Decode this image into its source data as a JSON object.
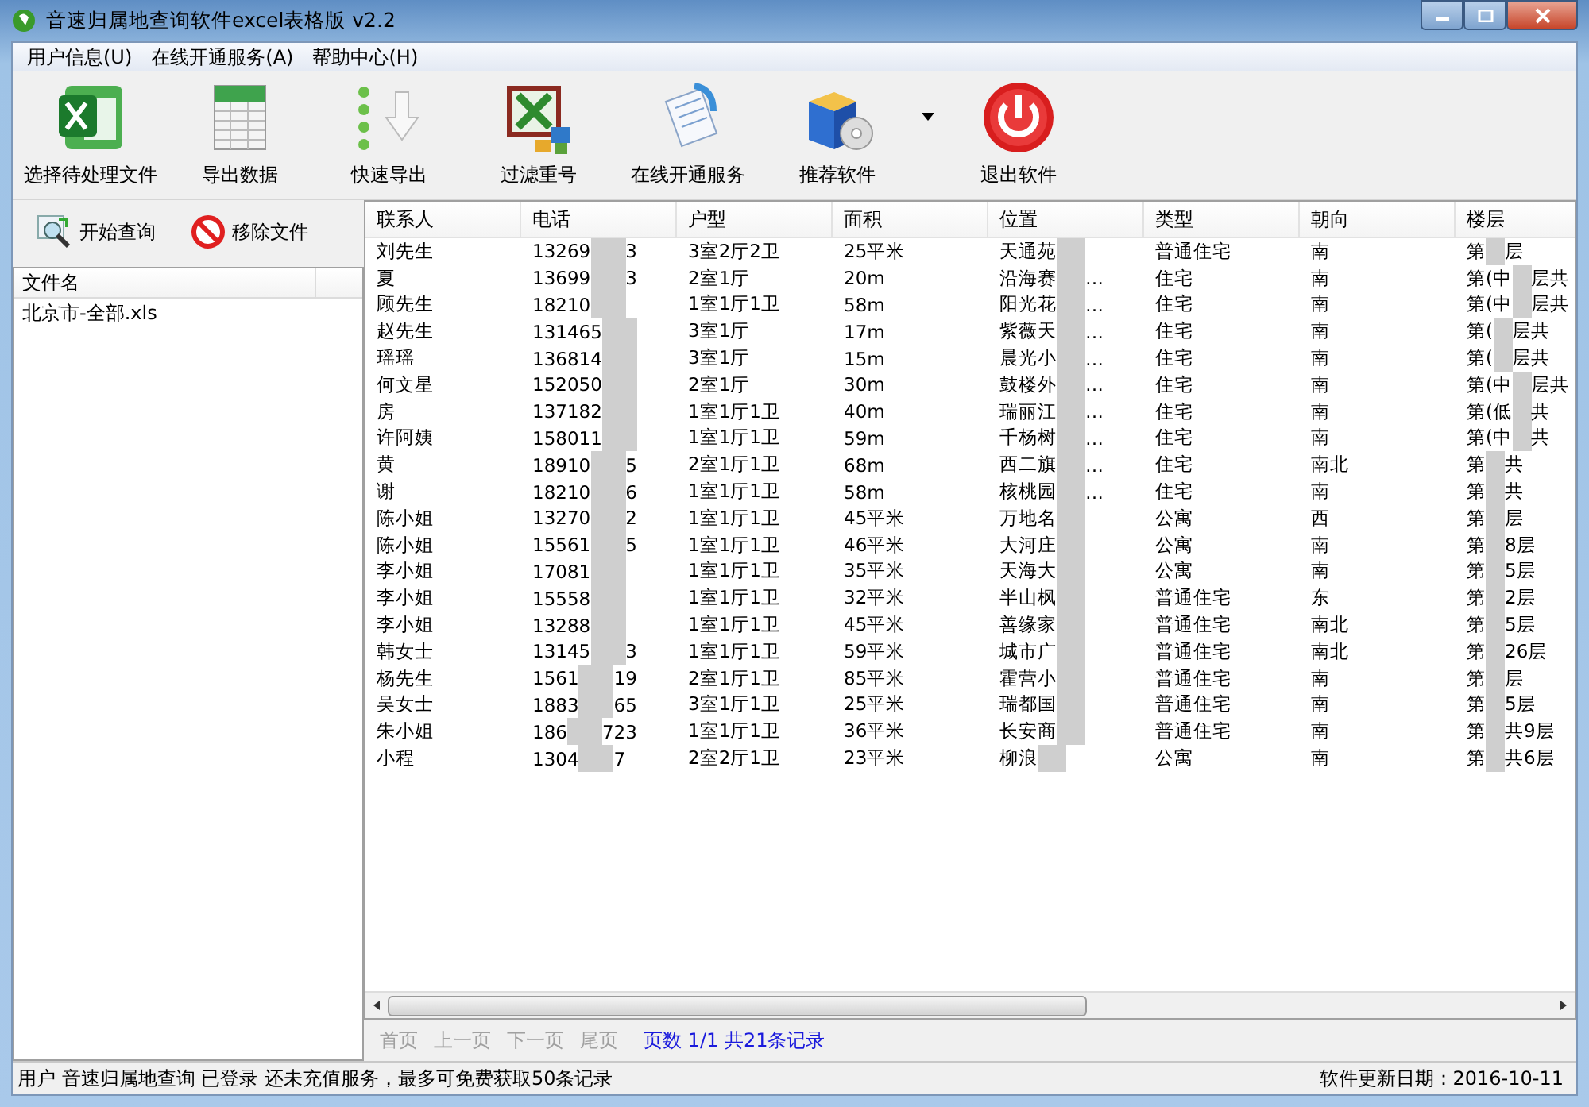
{
  "window": {
    "title": "音速归属地查询软件excel表格版 v2.2"
  },
  "menu": [
    "用户信息(U)",
    "在线开通服务(A)",
    "帮助中心(H)"
  ],
  "toolbar": [
    {
      "label": "选择待处理文件",
      "kind": "excel"
    },
    {
      "label": "导出数据",
      "kind": "sheet"
    },
    {
      "label": "快速导出",
      "kind": "export"
    },
    {
      "label": "过滤重号",
      "kind": "filter"
    },
    {
      "label": "在线开通服务",
      "kind": "online"
    },
    {
      "label": "推荐软件",
      "kind": "box",
      "dropdown": true
    },
    {
      "label": "退出软件",
      "kind": "exit"
    }
  ],
  "side_actions": [
    {
      "label": "开始查询",
      "kind": "search"
    },
    {
      "label": "移除文件",
      "kind": "remove"
    }
  ],
  "file_list": {
    "columns": [
      "文件名"
    ],
    "rows": [
      "北京市-全部.xls"
    ]
  },
  "table": {
    "columns": [
      "联系人",
      "电话",
      "户型",
      "面积",
      "位置",
      "类型",
      "朝向",
      "楼层"
    ],
    "rows": [
      {
        "contact": "刘先生",
        "phone": {
          "head": "13269",
          "tail": "3"
        },
        "layout": "3室2厅2卫",
        "area": "25平米",
        "location": {
          "head": "天通苑"
        },
        "type": "普通住宅",
        "facing": "南",
        "floor": {
          "head": "第",
          "tail": "层"
        }
      },
      {
        "contact": "夏",
        "phone": {
          "head": "13699",
          "tail": "3"
        },
        "layout": "2室1厅",
        "area": "20m",
        "location": {
          "head": "沿海赛",
          "tail": "…"
        },
        "type": "住宅",
        "facing": "南",
        "floor": {
          "head": "第(中",
          "tail": "层共"
        }
      },
      {
        "contact": "顾先生",
        "phone": {
          "head": "18210"
        },
        "layout": "1室1厅1卫",
        "area": "58m",
        "location": {
          "head": "阳光花",
          "tail": "…"
        },
        "type": "住宅",
        "facing": "南",
        "floor": {
          "head": "第(中",
          "tail": "层共"
        }
      },
      {
        "contact": "赵先生",
        "phone": {
          "head": "131465"
        },
        "layout": "3室1厅",
        "area": "17m",
        "location": {
          "head": "紫薇天",
          "tail": "…"
        },
        "type": "住宅",
        "facing": "南",
        "floor": {
          "head": "第(",
          "tail": "层共"
        }
      },
      {
        "contact": "瑶瑶",
        "phone": {
          "head": "136814"
        },
        "layout": "3室1厅",
        "area": "15m",
        "location": {
          "head": "晨光小",
          "tail": "…"
        },
        "type": "住宅",
        "facing": "南",
        "floor": {
          "head": "第(",
          "tail": "层共"
        }
      },
      {
        "contact": "何文星",
        "phone": {
          "head": "152050"
        },
        "layout": "2室1厅",
        "area": "30m",
        "location": {
          "head": "鼓楼外",
          "tail": "…"
        },
        "type": "住宅",
        "facing": "南",
        "floor": {
          "head": "第(中",
          "tail": "层共"
        }
      },
      {
        "contact": "房",
        "phone": {
          "head": "137182"
        },
        "layout": "1室1厅1卫",
        "area": "40m",
        "location": {
          "head": "瑞丽江",
          "tail": "…"
        },
        "type": "住宅",
        "facing": "南",
        "floor": {
          "head": "第(低",
          "tail": "共"
        }
      },
      {
        "contact": "许阿姨",
        "phone": {
          "head": "158011"
        },
        "layout": "1室1厅1卫",
        "area": "59m",
        "location": {
          "head": "千杨树",
          "tail": "…"
        },
        "type": "住宅",
        "facing": "南",
        "floor": {
          "head": "第(中",
          "tail": "共"
        }
      },
      {
        "contact": "黄",
        "phone": {
          "head": "18910",
          "tail": "5"
        },
        "layout": "2室1厅1卫",
        "area": "68m",
        "location": {
          "head": "西二旗",
          "tail": "…"
        },
        "type": "住宅",
        "facing": "南北",
        "floor": {
          "head": "第",
          "tail": "共"
        }
      },
      {
        "contact": "谢",
        "phone": {
          "head": "18210",
          "tail": "6"
        },
        "layout": "1室1厅1卫",
        "area": "58m",
        "location": {
          "head": "核桃园",
          "tail": "…"
        },
        "type": "住宅",
        "facing": "南",
        "floor": {
          "head": "第",
          "tail": "共"
        }
      },
      {
        "contact": "陈小姐",
        "phone": {
          "head": "13270",
          "tail": "2"
        },
        "layout": "1室1厅1卫",
        "area": "45平米",
        "location": {
          "head": "万地名"
        },
        "type": "公寓",
        "facing": "西",
        "floor": {
          "head": "第",
          "tail": "层"
        }
      },
      {
        "contact": "陈小姐",
        "phone": {
          "head": "15561",
          "tail": "5"
        },
        "layout": "1室1厅1卫",
        "area": "46平米",
        "location": {
          "head": "大河庄"
        },
        "type": "公寓",
        "facing": "南",
        "floor": {
          "head": "第",
          "tail": "8层"
        }
      },
      {
        "contact": "李小姐",
        "phone": {
          "head": "17081"
        },
        "layout": "1室1厅1卫",
        "area": "35平米",
        "location": {
          "head": "天海大"
        },
        "type": "公寓",
        "facing": "南",
        "floor": {
          "head": "第",
          "tail": "5层"
        }
      },
      {
        "contact": "李小姐",
        "phone": {
          "head": "15558"
        },
        "layout": "1室1厅1卫",
        "area": "32平米",
        "location": {
          "head": "半山枫"
        },
        "type": "普通住宅",
        "facing": "东",
        "floor": {
          "head": "第",
          "tail": "2层"
        }
      },
      {
        "contact": "李小姐",
        "phone": {
          "head": "13288"
        },
        "layout": "1室1厅1卫",
        "area": "45平米",
        "location": {
          "head": "善缘家"
        },
        "type": "普通住宅",
        "facing": "南北",
        "floor": {
          "head": "第",
          "tail": "5层"
        }
      },
      {
        "contact": "韩女士",
        "phone": {
          "head": "13145",
          "tail": "3"
        },
        "layout": "1室1厅1卫",
        "area": "59平米",
        "location": {
          "head": "城市广"
        },
        "type": "普通住宅",
        "facing": "南北",
        "floor": {
          "head": "第",
          "tail": "26层"
        }
      },
      {
        "contact": "杨先生",
        "phone": {
          "head": "1561",
          "tail": "19"
        },
        "layout": "2室1厅1卫",
        "area": "85平米",
        "location": {
          "head": "霍营小"
        },
        "type": "普通住宅",
        "facing": "南",
        "floor": {
          "head": "第",
          "tail": "层"
        }
      },
      {
        "contact": "吴女士",
        "phone": {
          "head": "1883",
          "tail": "65"
        },
        "layout": "3室1厅1卫",
        "area": "25平米",
        "location": {
          "head": "瑞都国"
        },
        "type": "普通住宅",
        "facing": "南",
        "floor": {
          "head": "第",
          "tail": "5层"
        }
      },
      {
        "contact": "朱小姐",
        "phone": {
          "head": "186",
          "tail": "723"
        },
        "layout": "1室1厅1卫",
        "area": "36平米",
        "location": {
          "head": "长安商"
        },
        "type": "普通住宅",
        "facing": "南",
        "floor": {
          "head": "第",
          "tail": "共9层"
        }
      },
      {
        "contact": "小程",
        "phone": {
          "head": "1304",
          "tail": "7"
        },
        "layout": "2室2厅1卫",
        "area": "23平米",
        "location": {
          "head": "柳浪"
        },
        "type": "公寓",
        "facing": "南",
        "floor": {
          "head": "第",
          "tail": "共6层"
        }
      }
    ]
  },
  "pager": {
    "links": [
      {
        "label": "首页",
        "disabled": true
      },
      {
        "label": "上一页",
        "disabled": true
      },
      {
        "label": "下一页",
        "disabled": true
      },
      {
        "label": "尾页",
        "disabled": true
      }
    ],
    "info": "页数 1/1 共21条记录"
  },
  "status_bar": {
    "left": "用户 音速归属地查询 已登录 还未充值服务，最多可免费获取50条记录",
    "right": "软件更新日期：2016-10-11"
  }
}
